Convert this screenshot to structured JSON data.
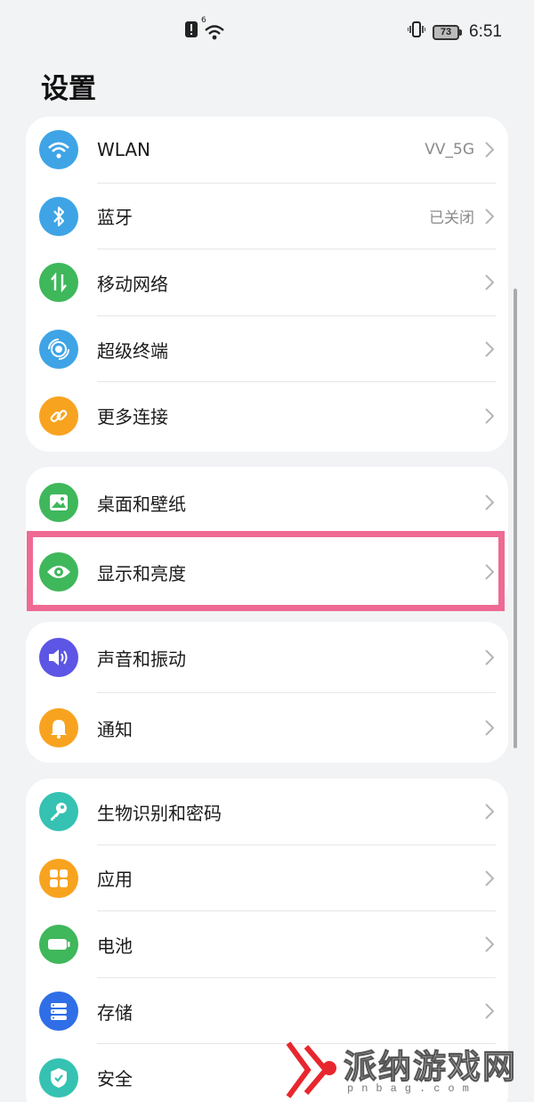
{
  "status_bar": {
    "time": "6:51",
    "battery": "73",
    "wifi_tag": "6",
    "icons": [
      "alert-icon",
      "wifi-icon",
      "vibrate-icon",
      "battery-icon"
    ]
  },
  "page": {
    "title": "设置"
  },
  "colors": {
    "background": "#f1f3f5",
    "card": "#ffffff",
    "highlight_border": "#ee6a93",
    "icon_blue": "#3ea4e6",
    "icon_green": "#3fb75b",
    "icon_orange": "#f8a320",
    "icon_purple": "#5c55e5",
    "icon_teal": "#35c2b2",
    "icon_navy": "#2f6ee6"
  },
  "groups": [
    {
      "items": [
        {
          "label": "WLAN",
          "value": "VV_5G",
          "icon": "wifi-icon"
        },
        {
          "label": "蓝牙",
          "value": "已关闭",
          "icon": "bluetooth-icon"
        },
        {
          "label": "移动网络",
          "value": "",
          "icon": "mobile-data-icon"
        },
        {
          "label": "超级终端",
          "value": "",
          "icon": "super-device-icon"
        },
        {
          "label": "更多连接",
          "value": "",
          "icon": "link-icon"
        }
      ]
    },
    {
      "items": [
        {
          "label": "桌面和壁纸",
          "value": "",
          "icon": "wallpaper-icon"
        },
        {
          "label": "显示和亮度",
          "value": "",
          "icon": "eye-icon",
          "highlighted": true
        }
      ]
    },
    {
      "items": [
        {
          "label": "声音和振动",
          "value": "",
          "icon": "speaker-icon"
        },
        {
          "label": "通知",
          "value": "",
          "icon": "bell-icon"
        }
      ]
    },
    {
      "items": [
        {
          "label": "生物识别和密码",
          "value": "",
          "icon": "key-icon"
        },
        {
          "label": "应用",
          "value": "",
          "icon": "apps-icon"
        },
        {
          "label": "电池",
          "value": "",
          "icon": "battery-icon"
        },
        {
          "label": "存储",
          "value": "",
          "icon": "storage-icon"
        },
        {
          "label": "安全",
          "value": "",
          "icon": "shield-icon"
        }
      ]
    }
  ],
  "watermark": {
    "text": "派纳游戏网",
    "url": "pnbag.com"
  }
}
